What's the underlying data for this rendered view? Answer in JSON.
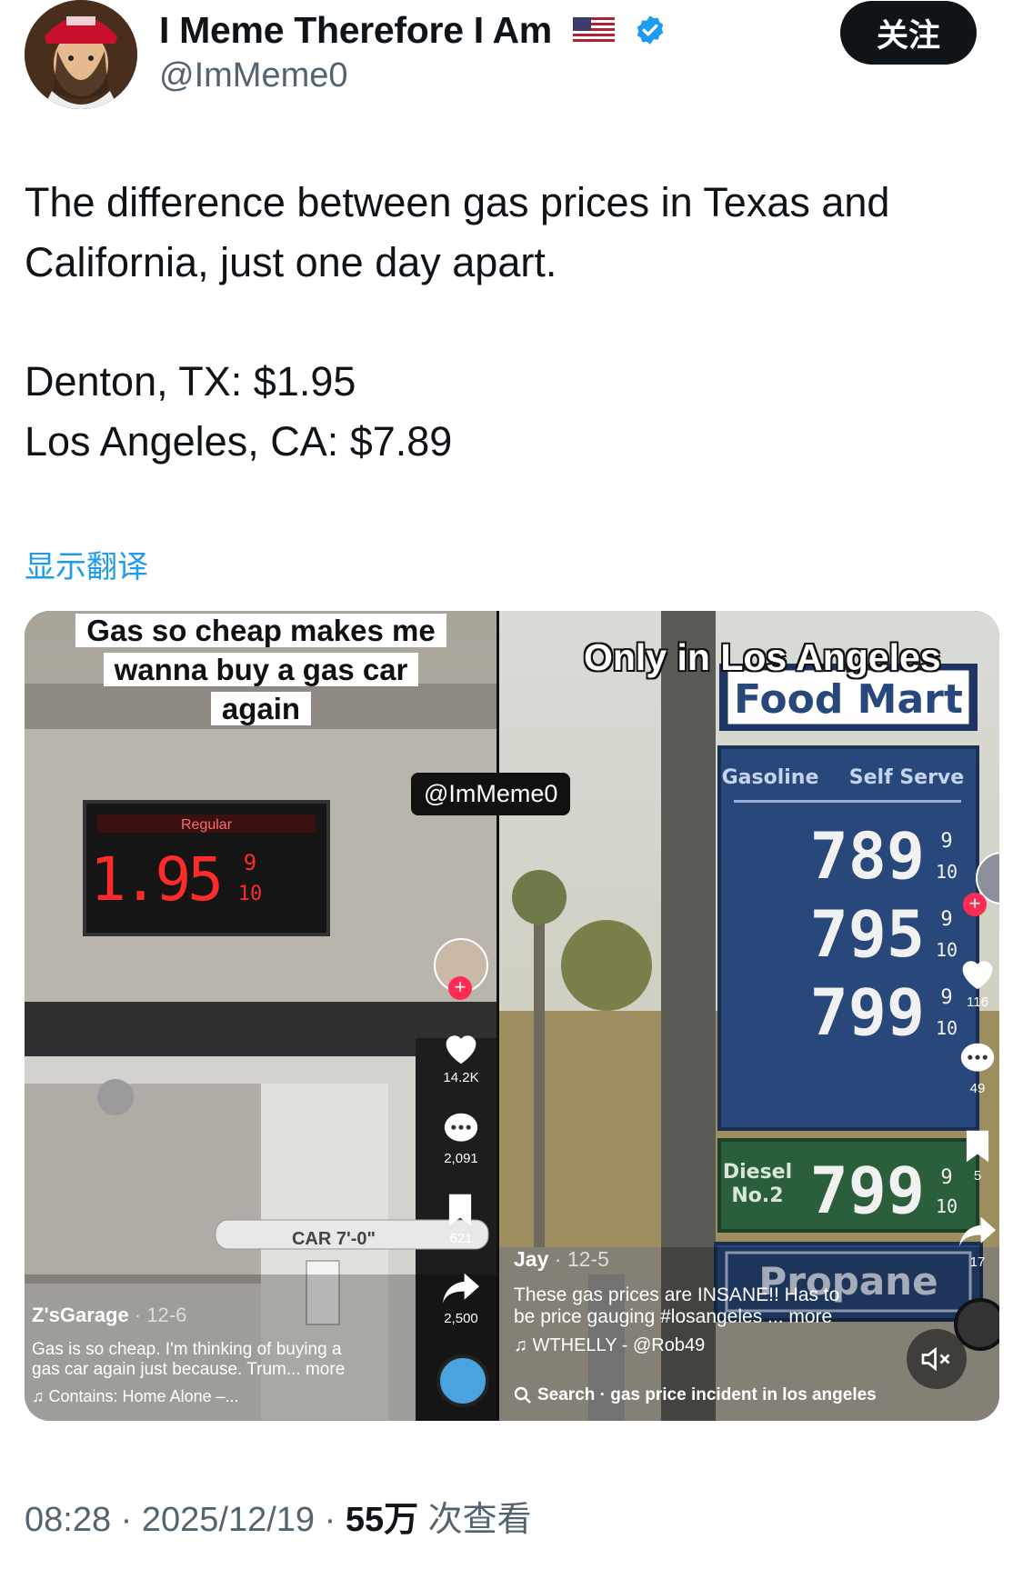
{
  "tweet": {
    "display_name": "I Meme Therefore I Am",
    "handle": "@ImMeme0",
    "follow_label": "关注",
    "text_line1": "The difference between gas prices in Texas and",
    "text_line2": "California, just one day apart.",
    "text_line3": "Denton, TX: $1.95",
    "text_line4": "Los Angeles, CA: $7.89",
    "translate_label": "显示翻译",
    "time": "08:28 · 2025/12/19 · ",
    "views": "55万",
    "views_suffix": " 次查看"
  },
  "left_panel": {
    "caption": [
      "Gas so cheap makes me",
      "wanna buy a gas car",
      "again"
    ],
    "sign_label": "Regular",
    "sign_price": "1.95",
    "sign_fraction_top": "9",
    "sign_fraction_bottom": "10",
    "clearance": "CAR 7'-0\"",
    "author": "Z'sGarage",
    "date": "12-6",
    "description": [
      "Gas is so cheap. I'm thinking of buying a",
      "gas car again just because. Trum... more"
    ],
    "sound": "♫ Contains: Home Alone –...",
    "likes": "14.2K",
    "comments": "2,091",
    "saves": "621",
    "shares": "2,500"
  },
  "watermark": "@ImMeme0",
  "right_panel": {
    "caption": "Only in Los Angeles",
    "store": "Food Mart",
    "header_left": "Gasoline",
    "header_right": "Self Serve",
    "prices": [
      "789",
      "795",
      "799"
    ],
    "fraction_top": "9",
    "fraction_bottom": "10",
    "diesel_label_1": "Diesel",
    "diesel_label_2": "No.2",
    "diesel_price": "799",
    "propane": "Propane",
    "author": "Jay",
    "date": "12-5",
    "description": [
      "These gas prices are INSANE!! Has to",
      "be price gauging  #losangeles ... more"
    ],
    "sound": "♫ WTHELLY - @Rob49",
    "search": "Search · gas price incident in los angeles",
    "likes": "116",
    "comments": "49",
    "saves": "5",
    "shares": "17"
  },
  "colors": {
    "accent": "#1d9bf0",
    "led_red": "#ff2a2a",
    "sign_blue": "#28477a",
    "diesel_green": "#2b5e3b"
  }
}
